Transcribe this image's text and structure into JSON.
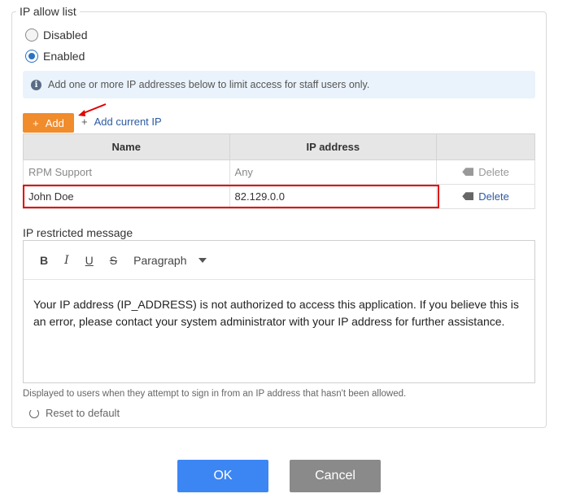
{
  "section": {
    "legend": "IP allow list",
    "radio_options": [
      {
        "label": "Disabled",
        "checked": false
      },
      {
        "label": "Enabled",
        "checked": true
      }
    ],
    "info_text": "Add one or more IP addresses below to limit access for staff users only.",
    "add_button": "Add",
    "add_current_ip": "Add current IP"
  },
  "table": {
    "headers": [
      "Name",
      "IP address",
      ""
    ],
    "rows": [
      {
        "name": "RPM Support",
        "ip": "Any",
        "action": "Delete",
        "disabled": true
      },
      {
        "name": "John Doe",
        "ip": "82.129.0.0",
        "action": "Delete",
        "disabled": false
      }
    ]
  },
  "message": {
    "label": "IP restricted message",
    "toolbar": {
      "bold": "B",
      "italic": "I",
      "underline": "U",
      "strike": "S",
      "format": "Paragraph"
    },
    "body": "Your IP address (IP_ADDRESS) is not authorized to access this application. If you believe this is an error, please contact your system administrator with your IP address for further assistance.",
    "help": "Displayed to users when they attempt to sign in from an IP address that hasn't been allowed.",
    "reset": "Reset to default"
  },
  "footer": {
    "ok": "OK",
    "cancel": "Cancel"
  },
  "colors": {
    "accent": "#f08c2c",
    "primary": "#3c86f4",
    "link": "#2c5aa0",
    "highlight": "#e00000"
  }
}
